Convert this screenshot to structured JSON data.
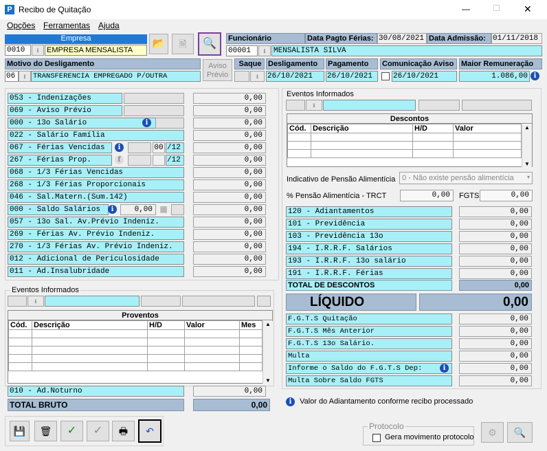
{
  "window": {
    "title": "Recibo de Quitação",
    "minimize": "—",
    "maximize": "☐",
    "close": "✕"
  },
  "menu": [
    "Opções",
    "Ferramentas",
    "Ajuda"
  ],
  "empresa": {
    "header": "Empresa",
    "code": "0010",
    "name": "EMPRESA MENSALISTA"
  },
  "funcionario": {
    "header": "Funcionário",
    "code": "00001",
    "name": "MENSALISTA SILVA"
  },
  "data_pagto_ferias": {
    "label": "Data Pagto Férias:",
    "value": "30/08/2021"
  },
  "data_admissao": {
    "label": "Data Admissão:",
    "value": "01/11/2018"
  },
  "motivo": {
    "header": "Motivo do Desligamento",
    "code": "06",
    "name": "TRANSFERENCIA EMPREGADO P/OUTRA"
  },
  "aviso_previo_btn": "Aviso Prévio",
  "saque": {
    "header": "Saque"
  },
  "desligamento": {
    "header": "Desligamento",
    "value": "26/10/2021"
  },
  "pagamento": {
    "header": "Pagamento",
    "value": "26/10/2021"
  },
  "comunicacao": {
    "header": "Comunicação Aviso",
    "value": "26/10/2021"
  },
  "maior_remuneracao": {
    "header": "Maior Remuneração",
    "value": "1.086,00"
  },
  "proventos_items": [
    {
      "label": "053 - Indenizações",
      "value": "0,00"
    },
    {
      "label": "069 - Aviso Prévio",
      "value": "0,00"
    },
    {
      "label": "000 - 13o Salário",
      "value": "0,00"
    },
    {
      "label": "022 - Salário Família",
      "value": "0,00"
    },
    {
      "label": "067 - Férias Vencidas",
      "sub1": "00",
      "sub2": "/12",
      "value": "0,00"
    },
    {
      "label": "267 - Férias Prop.",
      "sub1": "",
      "sub2": "/12",
      "value": "0,00"
    },
    {
      "label": "068 - 1/3 Férias Vencidas",
      "value": "0,00"
    },
    {
      "label": "268 - 1/3 Férias Proporcionais",
      "value": "0,00"
    },
    {
      "label": "046 - Sal.Matern.(Sum.142)",
      "value": "0,00"
    },
    {
      "label": "000 - Saldo Salários",
      "sub1": "0,00",
      "value": "0,00"
    },
    {
      "label": "057 - 13o Sal. Av.Prévio Indeniz.",
      "value": "0,00"
    },
    {
      "label": "269 - Férias  Av. Prévio Indeniz.",
      "value": "0,00"
    },
    {
      "label": "270 - 1/3 Férias Av. Prévio Indeniz.",
      "value": "0,00"
    },
    {
      "label": "012 - Adicional de Periculosidade",
      "value": "0,00"
    },
    {
      "label": "011 - Ad.Insalubridade",
      "value": "0,00"
    }
  ],
  "eventos_left": {
    "legend": "Eventos Informados"
  },
  "proventos_table": {
    "title": "Proventos",
    "columns": [
      "Cód.",
      "Descrição",
      "H/D",
      "Valor",
      "Mes"
    ]
  },
  "ad_noturno": {
    "label": "010 - Ad.Noturno",
    "value": "0,00"
  },
  "total_bruto": {
    "label": "TOTAL BRUTO",
    "value": "0,00"
  },
  "eventos_right": {
    "legend": "Eventos Informados"
  },
  "descontos_table": {
    "title": "Descontos",
    "columns": [
      "Cód.",
      "Descrição",
      "H/D",
      "Valor"
    ]
  },
  "pensao": {
    "label": "Indicativo de Pensão Alimentícia",
    "value": "0 - Não existe pensão alimentícia"
  },
  "pensao_pct": {
    "label": "% Pensão Alimentícia - TRCT",
    "value": "0,00"
  },
  "fgts": {
    "label": "FGTS",
    "value": "0,00"
  },
  "descontos_items": [
    {
      "label": "120 - Adiantamentos",
      "value": "0,00"
    },
    {
      "label": "101 - Previdência",
      "value": "0,00"
    },
    {
      "label": "103 - Previdência 13o",
      "value": "0,00"
    },
    {
      "label": "194 - I.R.R.F. Salários",
      "value": "0,00"
    },
    {
      "label": "193 - I.R.R.F. 13o salário",
      "value": "0,00"
    },
    {
      "label": "191 - I.R.R.F. Férias",
      "value": "0,00"
    }
  ],
  "total_descontos": {
    "label": "TOTAL DE DESCONTOS",
    "value": "0,00"
  },
  "liquido": {
    "label": "LÍQUIDO",
    "value": "0,00"
  },
  "fgts_items": [
    {
      "label": "F.G.T.S  Quitação",
      "value": "0,00"
    },
    {
      "label": "F.G.T.S  Mês Anterior",
      "value": "0,00"
    },
    {
      "label": "F.G.T.S  13o Salário.",
      "value": "0,00"
    },
    {
      "label": "Multa",
      "value": "0,00"
    },
    {
      "label": "Informe o Saldo do F.G.T.S Dep:",
      "value": "0,00"
    },
    {
      "label": "Multa Sobre Saldo FGTS",
      "value": "0,00"
    }
  ],
  "info_msg": "Valor do Adiantamento conforme recibo processado",
  "protocolo": {
    "legend": "Protocolo",
    "checkbox": "Gera movimento protocolo"
  },
  "colors": {
    "cyan": "#a8f0f8",
    "header": "#a8bdd3",
    "accent": "#7b3fa0"
  }
}
